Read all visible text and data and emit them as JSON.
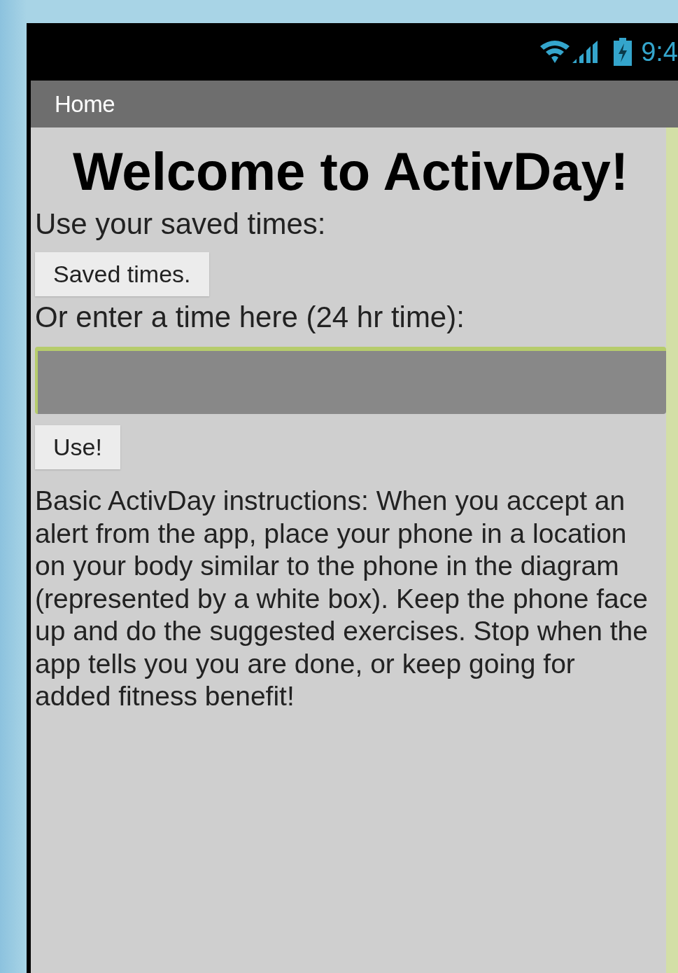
{
  "status_bar": {
    "time": "9:4"
  },
  "action_bar": {
    "title": "Home"
  },
  "heading": "Welcome to ActivDay!",
  "saved_label": "Use your saved times:",
  "saved_button": "Saved times.",
  "enter_label": "Or enter a time here (24 hr time):",
  "time_field": {
    "focused": true
  },
  "use_button": "Use!",
  "instructions": "Basic ActivDay instructions: When you accept an alert from the app, place your phone in a location on your body similar to the phone in the diagram (represented by a white box). Keep the phone face up and do the suggested exercises. Stop when the app tells you you are done, or keep going for added fitness benefit!"
}
